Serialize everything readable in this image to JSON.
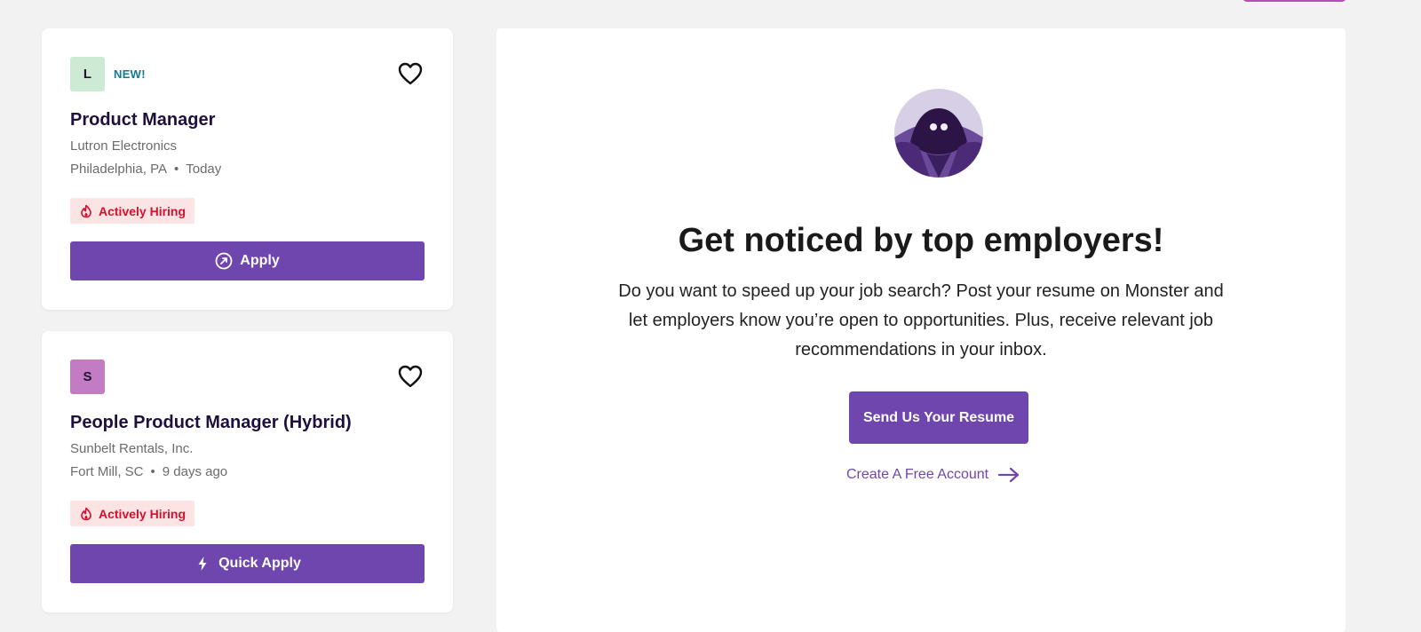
{
  "cards": [
    {
      "logo_letter": "L",
      "badge": "NEW!",
      "title": "Product Manager",
      "company": "Lutron Electronics",
      "location": "Philadelphia, PA",
      "dot": "•",
      "posted": "Today",
      "hiring_label": "Actively Hiring",
      "button_label": "Apply",
      "button_icon": "external-apply-icon"
    },
    {
      "logo_letter": "S",
      "title": "People Product Manager (Hybrid)",
      "company": "Sunbelt Rentals, Inc.",
      "location": "Fort Mill, SC",
      "dot": "•",
      "posted": "9 days ago",
      "hiring_label": "Actively Hiring",
      "button_label": "Quick Apply",
      "button_icon": "lightning-icon"
    }
  ],
  "promo": {
    "title": "Get noticed by top employers!",
    "body": "Do you want to speed up your job search? Post your resume on Monster and let employers know you’re open to opportunities. Plus, receive relevant job recommendations in your inbox.",
    "resume_button": "Send Us Your Resume",
    "create_account_link": "Create A Free Account"
  },
  "colors": {
    "brand_purple": "#6e46ae",
    "new_badge": "#117b93",
    "hiring_red": "#d3102e",
    "hiring_bg": "#fde4e4"
  }
}
